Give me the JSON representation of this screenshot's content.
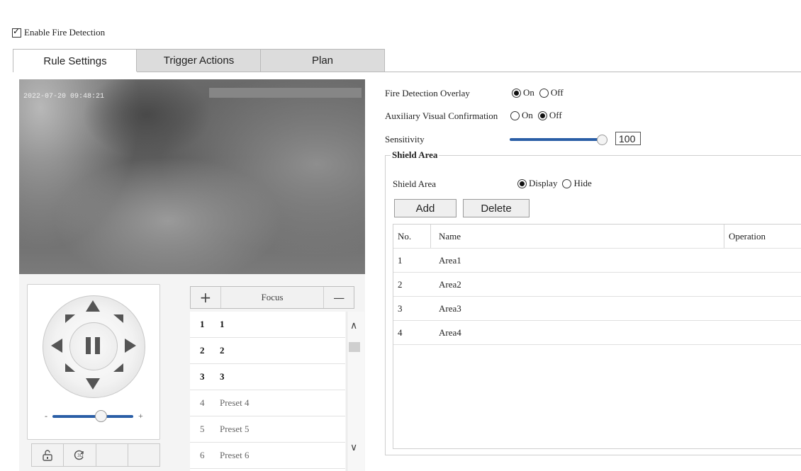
{
  "enable_fire_detection": {
    "label": "Enable Fire Detection",
    "checked": true
  },
  "tabs": [
    {
      "label": "Rule Settings",
      "active": true
    },
    {
      "label": "Trigger Actions",
      "active": false
    },
    {
      "label": "Plan",
      "active": false
    }
  ],
  "video": {
    "timestamp": "2022-07-20 09:48:21"
  },
  "ptz": {
    "speed_minus": "-",
    "speed_plus": "+",
    "speed_level": 0.6,
    "icons": [
      "lock-icon",
      "3d-zoom-icon"
    ]
  },
  "focus": {
    "plus": "+",
    "label": "Focus",
    "minus": "—"
  },
  "presets": [
    {
      "no": "1",
      "name": "1",
      "bold": true
    },
    {
      "no": "2",
      "name": "2",
      "bold": true
    },
    {
      "no": "3",
      "name": "3",
      "bold": true
    },
    {
      "no": "4",
      "name": "Preset 4",
      "bold": false
    },
    {
      "no": "5",
      "name": "Preset 5",
      "bold": false
    },
    {
      "no": "6",
      "name": "Preset 6",
      "bold": false
    }
  ],
  "settings": {
    "overlay": {
      "label": "Fire Detection Overlay",
      "on": "On",
      "off": "Off",
      "value": "On"
    },
    "aux": {
      "label": "Auxiliary Visual Confirmation",
      "on": "On",
      "off": "Off",
      "value": "Off"
    },
    "sensitivity": {
      "label": "Sensitivity",
      "value": "100",
      "max": 100
    }
  },
  "shield": {
    "legend": "Shield Area",
    "label": "Shield Area",
    "display": "Display",
    "hide": "Hide",
    "value": "Display",
    "add": "Add",
    "delete": "Delete",
    "columns": {
      "no": "No.",
      "name": "Name",
      "operation": "Operation"
    },
    "rows": [
      {
        "no": "1",
        "name": "Area1"
      },
      {
        "no": "2",
        "name": "Area2"
      },
      {
        "no": "3",
        "name": "Area3"
      },
      {
        "no": "4",
        "name": "Area4"
      }
    ]
  },
  "colors": {
    "slider_blue": "#2a5ea6",
    "tab_inactive": "#dcdcdc"
  }
}
